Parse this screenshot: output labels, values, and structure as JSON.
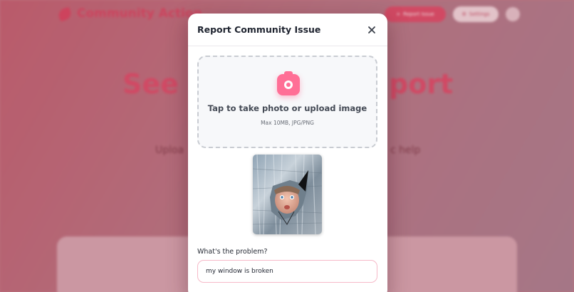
{
  "background": {
    "brand": "Community Action",
    "report_button_label": "Report Issue",
    "settings_button_label": "Settings",
    "hero_left": "See S",
    "hero_right": "port",
    "subtitle_left": "Uploa",
    "subtitle_right": "c help"
  },
  "modal": {
    "title": "Report Community Issue",
    "upload": {
      "title": "Tap to take photo or upload image",
      "hint": "Max 10MB, JPG/PNG"
    },
    "problem": {
      "label": "What's the problem?",
      "value": "my window is broken"
    }
  },
  "colors": {
    "accent": "#ff6f96",
    "brand": "#de4a67"
  },
  "icons": {
    "close": "close-icon",
    "camera": "camera-icon"
  }
}
